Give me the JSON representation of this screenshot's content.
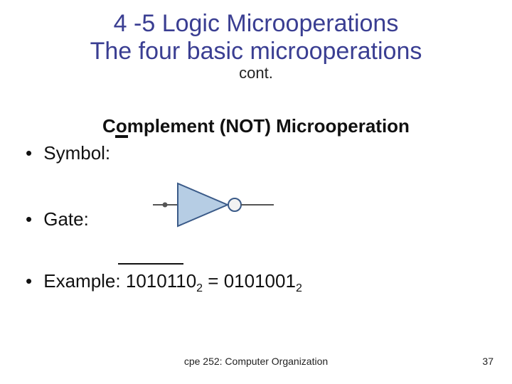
{
  "title": {
    "line1": "4 -5 Logic Microoperations",
    "line2": "The four basic microoperations",
    "sub": "cont."
  },
  "section": "Complement (NOT) Microoperation",
  "bullets": {
    "symbol_label": "Symbol:",
    "gate_label": "Gate:",
    "example_label": "Example:",
    "example_lhs": "1010110",
    "example_lhs_sub": "2",
    "example_eq": " = ",
    "example_rhs": "0101001",
    "example_rhs_sub": "2"
  },
  "footer": {
    "course": "cpe 252: Computer Organization",
    "page": "37"
  }
}
